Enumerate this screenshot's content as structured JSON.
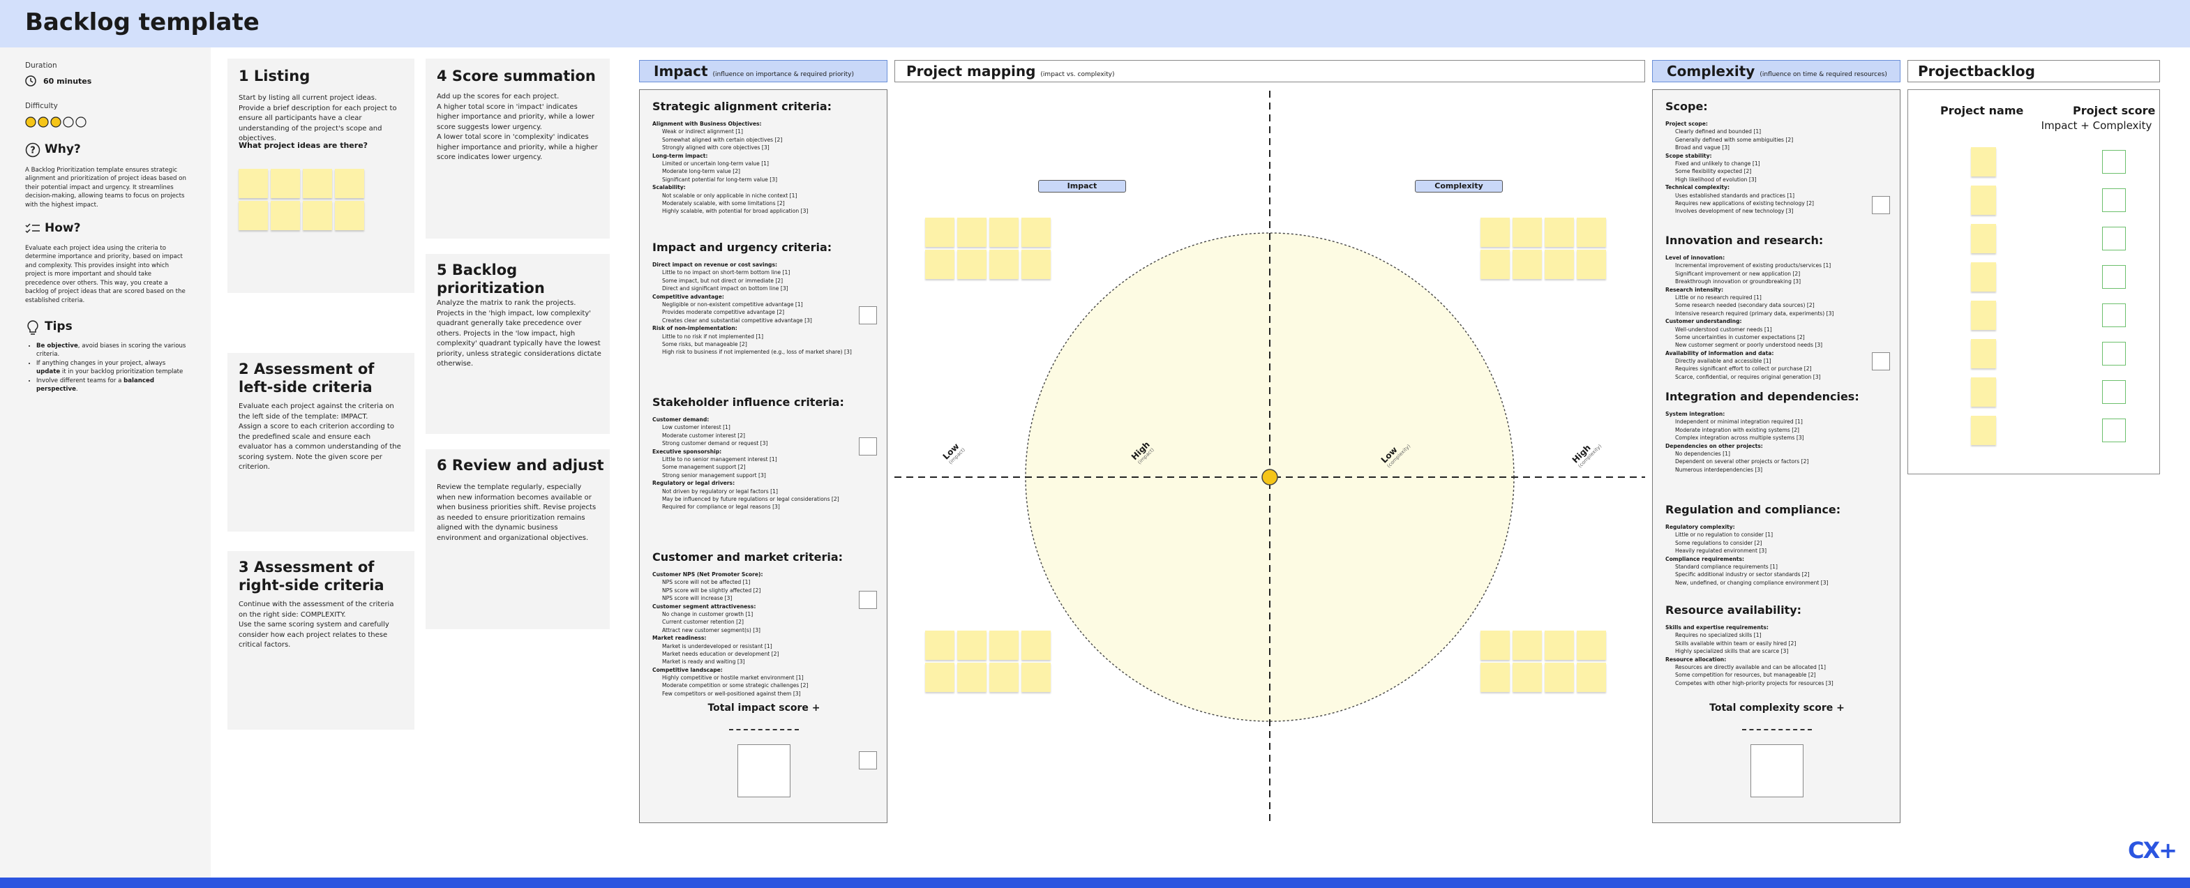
{
  "header": {
    "title": "Backlog template"
  },
  "sidebar": {
    "duration_label": "Duration",
    "duration_value": "60 minutes",
    "difficulty_label": "Difficulty",
    "why_title": "Why?",
    "why_text": "A Backlog Prioritization template ensures strategic alignment and prioritization of project ideas based on their potential impact and urgency. It streamlines decision-making, allowing teams to focus on projects with the highest impact.",
    "how_title": "How?",
    "how_text": "Evaluate each project idea using the criteria to determine importance and priority, based on impact and complexity. This provides insight into which project is more important and should take precedence over others. This way, you create a backlog of project ideas that are scored based on the established criteria.",
    "tips_title": "Tips",
    "tips": [
      {
        "b": "Be objective",
        "t": ", avoid biases in scoring the various criteria."
      },
      {
        "pre": "If anything changes in your project, always ",
        "b": "update",
        "t": " it in your backlog prioritization template"
      },
      {
        "pre": "Involve different teams for a ",
        "b": "balanced perspective",
        "t": "."
      }
    ]
  },
  "steps": [
    {
      "title": "1 Listing",
      "text": "Start by listing all current project ideas. Provide a brief description for each project to ensure all participants have a clear understanding of the project's scope and objectives.",
      "sub": "What project ideas are there?"
    },
    {
      "title": "2 Assessment of left-side criteria",
      "text": "Evaluate each project against the criteria on the left side of the template: IMPACT.\nAssign a score to each criterion according to the predefined scale and ensure each evaluator has a common understanding of the scoring system. Note the given score per criterion."
    },
    {
      "title": "3 Assessment of right-side criteria",
      "text": "Continue with the assessment of the criteria on the right side: COMPLEXITY.\nUse the same scoring system and carefully consider how each project relates to these critical factors."
    },
    {
      "title": "4 Score summation",
      "text": "Add up the scores for each project.\nA higher total score in 'impact' indicates higher importance and priority, while a lower score suggests lower urgency.\nA lower total score in 'complexity' indicates higher importance and priority, while a higher score indicates lower urgency."
    },
    {
      "title": "5 Backlog prioritization",
      "text": "Analyze the matrix to rank the projects. Projects in the 'high impact, low complexity' quadrant generally take precedence over others. Projects in the 'low impact, high complexity' quadrant typically have the lowest priority, unless strategic considerations dictate otherwise."
    },
    {
      "title": "6 Review and adjust",
      "text": "Review the template regularly, especially when new information becomes available or when business priorities shift. Revise projects as needed to ensure prioritization remains aligned with the dynamic business environment and organizational objectives."
    }
  ],
  "impact": {
    "title": "Impact",
    "subtitle": "(influence on importance & required priority)",
    "total": "Total impact score +",
    "sections": [
      {
        "title": "Strategic alignment criteria:",
        "groups": [
          {
            "name": "Alignment with Business Objectives:",
            "items": [
              "Weak or indirect alignment [1]",
              "Somewhat aligned with certain objectives [2]",
              "Strongly aligned with core objectives [3]"
            ]
          },
          {
            "name": "Long-term impact:",
            "items": [
              "Limited or uncertain long-term value [1]",
              "Moderate long-term value [2]",
              "Significant potential for long-term value [3]"
            ]
          },
          {
            "name": "Scalability:",
            "items": [
              "Not scalable or only applicable in niche context [1]",
              "Moderately scalable, with some limitations [2]",
              "Highly scalable, with potential for broad application [3]"
            ]
          }
        ]
      },
      {
        "title": "Impact and urgency criteria:",
        "groups": [
          {
            "name": "Direct impact on revenue or cost savings:",
            "items": [
              "Little to no impact on short-term bottom line [1]",
              "Some impact, but not direct or immediate [2]",
              "Direct and significant impact on bottom line [3]"
            ]
          },
          {
            "name": "Competitive advantage:",
            "items": [
              "Negligible or non-existent competitive advantage [1]",
              "Provides moderate competitive advantage [2]",
              "Creates clear and substantial competitive advantage [3]"
            ]
          },
          {
            "name": "Risk of non-implementation:",
            "items": [
              "Little to no risk if not implemented [1]",
              "Some risks, but manageable [2]",
              "High risk to business if not implemented (e.g., loss of market share) [3]"
            ]
          }
        ]
      },
      {
        "title": "Stakeholder influence criteria:",
        "groups": [
          {
            "name": "Customer demand:",
            "items": [
              "Low customer interest [1]",
              "Moderate customer interest [2]",
              "Strong customer demand or request [3]"
            ]
          },
          {
            "name": "Executive sponsorship:",
            "items": [
              "Little to no senior management interest [1]",
              "Some management support [2]",
              "Strong senior management support [3]"
            ]
          },
          {
            "name": "Regulatory or legal drivers:",
            "items": [
              "Not driven by regulatory or legal factors [1]",
              "May be influenced by future regulations or legal considerations [2]",
              "Required for compliance or legal reasons [3]"
            ]
          }
        ]
      },
      {
        "title": "Customer and market criteria:",
        "groups": [
          {
            "name": "Customer NPS (Net Promoter Score):",
            "items": [
              "NPS score will not be affected [1]",
              "NPS score will be slightly affected [2]",
              "NPS score will increase [3]"
            ]
          },
          {
            "name": "Customer segment attractiveness:",
            "items": [
              "No change in customer growth [1]",
              "Current customer retention [2]",
              "Attract new customer segment(s) [3]"
            ]
          },
          {
            "name": "Market readiness:",
            "items": [
              "Market is underdeveloped or resistant [1]",
              "Market needs education or development [2]",
              "Market is ready and waiting [3]"
            ]
          },
          {
            "name": "Competitive landscape:",
            "items": [
              "Highly competitive or hostile market environment [1]",
              "Moderate competition or some strategic challenges [2]",
              "Few competitors or well-positioned against them [3]"
            ]
          }
        ]
      }
    ]
  },
  "mapping": {
    "title": "Project mapping",
    "subtitle": "(impact vs. complexity)",
    "impact_pill": "Impact",
    "complexity_pill": "Complexity",
    "labels": [
      {
        "t": "Low",
        "s": "(impact)"
      },
      {
        "t": "High",
        "s": "(impact)"
      },
      {
        "t": "Low",
        "s": "(complexity)"
      },
      {
        "t": "High",
        "s": "(complexity)"
      }
    ]
  },
  "complexity": {
    "title": "Complexity",
    "subtitle": "(influence on time & required resources)",
    "total": "Total complexity score +",
    "sections": [
      {
        "title": "Scope:",
        "groups": [
          {
            "name": "Project scope:",
            "items": [
              "Clearly defined and bounded [1]",
              "Generally defined with some ambiguities [2]",
              "Broad and vague [3]"
            ]
          },
          {
            "name": "Scope stability:",
            "items": [
              "Fixed and unlikely to change [1]",
              "Some flexibility expected [2]",
              "High likelihood of evolution [3]"
            ]
          },
          {
            "name": "Technical complexity:",
            "items": [
              "Uses established standards and practices [1]",
              "Requires new applications of existing technology [2]",
              "Involves development of new technology [3]"
            ]
          }
        ]
      },
      {
        "title": "Innovation and research:",
        "groups": [
          {
            "name": "Level of innovation:",
            "items": [
              "Incremental improvement of existing products/services [1]",
              "Significant improvement or new application [2]",
              "Breakthrough innovation or groundbreaking [3]"
            ]
          },
          {
            "name": "Research intensity:",
            "items": [
              "Little or no research required [1]",
              "Some research needed (secondary data sources) [2]",
              "Intensive research required (primary data, experiments) [3]"
            ]
          },
          {
            "name": "Customer understanding:",
            "items": [
              "Well-understood customer needs [1]",
              "Some uncertainties in customer expectations [2]",
              "New customer segment or poorly understood needs [3]"
            ]
          },
          {
            "name": "Availability of information and data:",
            "items": [
              "Directly available and accessible [1]",
              "Requires significant effort to collect or purchase [2]",
              "Scarce, confidential, or requires original generation [3]"
            ]
          }
        ]
      },
      {
        "title": "Integration and dependencies:",
        "groups": [
          {
            "name": "System integration:",
            "items": [
              "Independent or minimal integration required [1]",
              "Moderate integration with existing systems [2]",
              "Complex integration across multiple systems [3]"
            ]
          },
          {
            "name": "Dependencies on other projects:",
            "items": [
              "No dependencies [1]",
              "Dependent on several other projects or factors [2]",
              "Numerous interdependencies [3]"
            ]
          }
        ]
      },
      {
        "title": "Regulation and compliance:",
        "groups": [
          {
            "name": "Regulatory complexity:",
            "items": [
              "Little or no regulation to consider [1]",
              "Some regulations to consider [2]",
              "Heavily regulated environment [3]"
            ]
          },
          {
            "name": "Compliance requirements:",
            "items": [
              "Standard compliance requirements [1]",
              "Specific additional industry or sector standards [2]",
              "New, undefined, or changing compliance environment [3]"
            ]
          }
        ]
      },
      {
        "title": "Resource availability:",
        "groups": [
          {
            "name": "Skills and expertise requirements:",
            "items": [
              "Requires no specialized skills [1]",
              "Skills available within team or easily hired [2]",
              "Highly specialized skills that are scarce [3]"
            ]
          },
          {
            "name": "Resource allocation:",
            "items": [
              "Resources are directly available and can be allocated [1]",
              "Some competition for resources, but manageable [2]",
              "Competes with other high-priority projects for resources [3]"
            ]
          }
        ]
      }
    ]
  },
  "backlog": {
    "title": "Projectbacklog",
    "col_name": "Project name",
    "col_score": "Project score",
    "col_score_sub": "Impact + Complexity"
  },
  "logo": "CX+",
  "colors": {
    "accent": "#2b55e0",
    "header": "#d3e0fb",
    "sticky": "#fdf2a8",
    "circle": "#fdfbe3",
    "dot": "#f5c518"
  }
}
